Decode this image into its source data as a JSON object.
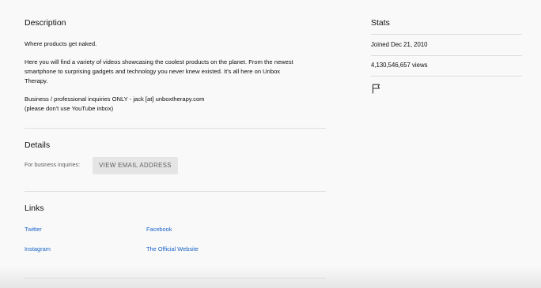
{
  "description": {
    "heading": "Description",
    "lines": [
      "Where products get naked.",
      "Here you will find a variety of videos showcasing the coolest products on the planet. From the newest",
      "smartphone to surprising gadgets and technology you never knew existed. It's all here on Unbox",
      "Therapy.",
      "Business / professional inquiries ONLY - jack [at] unboxtherapy.com",
      "(please don't use YouTube inbox)"
    ]
  },
  "details": {
    "heading": "Details",
    "business_label": "For business inquiries:",
    "email_button_label": "VIEW EMAIL ADDRESS"
  },
  "links": {
    "heading": "Links",
    "items": [
      {
        "label": "Twitter"
      },
      {
        "label": "Facebook"
      },
      {
        "label": "Instagram"
      },
      {
        "label": "The Official Website"
      }
    ]
  },
  "stats": {
    "heading": "Stats",
    "joined": "Joined Dec 21, 2010",
    "views": "4,130,546,657 views"
  },
  "icons": {
    "report": "flag-icon"
  },
  "colors": {
    "link": "#1a64c7",
    "button_bg": "#e5e5e5",
    "background": "#f9f9f9"
  }
}
